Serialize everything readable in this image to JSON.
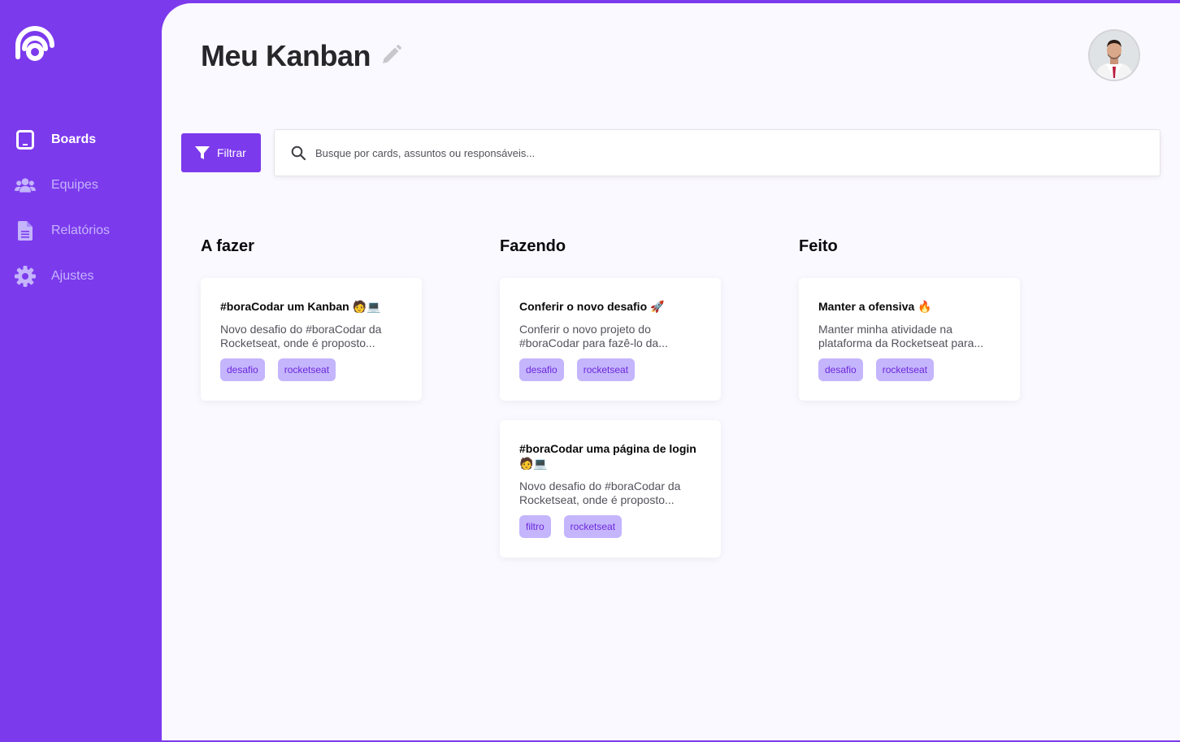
{
  "app": {
    "title": "Meu Kanban",
    "accent": "#7c3aed",
    "tag_bg": "#c4b5fd",
    "tag_text": "#6d28d9"
  },
  "sidebar": {
    "items": [
      {
        "label": "Boards",
        "icon": "tablet-icon",
        "active": true
      },
      {
        "label": "Equipes",
        "icon": "users-icon",
        "active": false
      },
      {
        "label": "Relatórios",
        "icon": "document-icon",
        "active": false
      },
      {
        "label": "Ajustes",
        "icon": "gear-icon",
        "active": false
      }
    ]
  },
  "toolbar": {
    "filter_label": "Filtrar",
    "search_placeholder": "Busque por cards, assuntos ou responsáveis..."
  },
  "columns": [
    {
      "title": "A fazer",
      "cards": [
        {
          "title": "#boraCodar um Kanban 🧑💻",
          "description": "Novo desafio do #boraCodar da Rocketseat, onde é proposto...",
          "tags": [
            "desafio",
            "rocketseat"
          ]
        }
      ]
    },
    {
      "title": "Fazendo",
      "cards": [
        {
          "title": "Conferir o novo desafio 🚀",
          "description": "Conferir o novo projeto do #boraCodar para fazê-lo da...",
          "tags": [
            "desafio",
            "rocketseat"
          ]
        },
        {
          "title": "#boraCodar uma página de login 🧑💻",
          "description": "Novo desafio do #boraCodar da Rocketseat, onde é proposto...",
          "tags": [
            "filtro",
            "rocketseat"
          ]
        }
      ]
    },
    {
      "title": "Feito",
      "cards": [
        {
          "title": "Manter a ofensiva 🔥",
          "description": "Manter minha atividade na plataforma da Rocketseat para...",
          "tags": [
            "desafio",
            "rocketseat"
          ]
        }
      ]
    }
  ]
}
